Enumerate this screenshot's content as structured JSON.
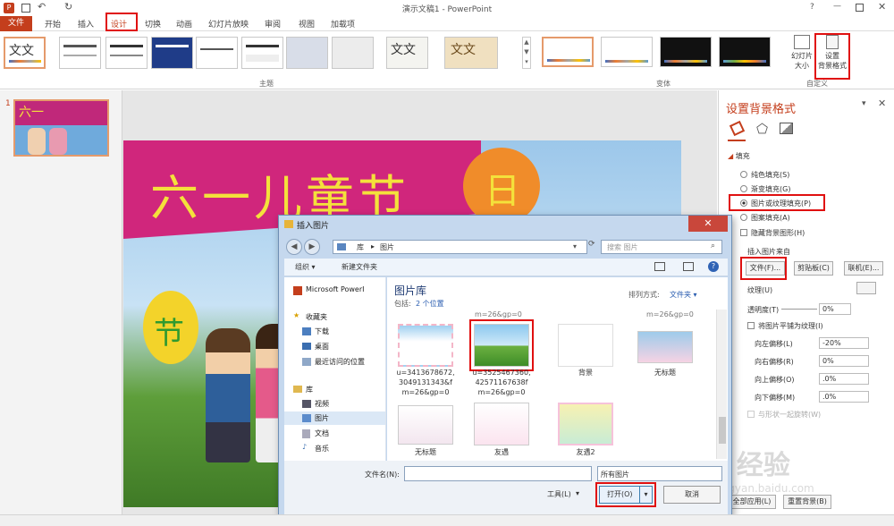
{
  "titlebar": {
    "title": "演示文稿1 - PowerPoint",
    "help": "?"
  },
  "tabs": [
    "文件",
    "开始",
    "插入",
    "设计",
    "切换",
    "动画",
    "幻灯片放映",
    "审阅",
    "视图",
    "加载项"
  ],
  "ribbon": {
    "group_theme": "主题",
    "group_variant": "变体",
    "group_custom": "自定义",
    "theme_text": "文文",
    "slide_size_line1": "幻灯片",
    "slide_size_line2": "大小",
    "format_bg_line1": "设置",
    "format_bg_line2": "背景格式"
  },
  "thumbnail": {
    "number": "1"
  },
  "slide": {
    "title": "六一儿童节",
    "sun_char": "日",
    "jie_char": "节"
  },
  "pane": {
    "title": "设置背景格式",
    "section_fill": "填充",
    "options": [
      "纯色填充(S)",
      "渐变填充(G)",
      "图片或纹理填充(P)",
      "图案填充(A)"
    ],
    "hide_bg": "隐藏背景图形(H)",
    "insert_from": "插入图片来自",
    "btn_file": "文件(F)...",
    "btn_clipboard": "剪贴板(C)",
    "btn_online": "联机(E)...",
    "texture": "纹理(U)",
    "transparency": "透明度(T)",
    "transparency_value": "0%",
    "tile": "将图片平铺为纹理(I)",
    "offsets": [
      {
        "label": "向左偏移(L)",
        "value": "-20%"
      },
      {
        "label": "向右偏移(R)",
        "value": "0%"
      },
      {
        "label": "向上偏移(O)",
        "value": ".0%"
      },
      {
        "label": "向下偏移(M)",
        "value": ".0%"
      }
    ],
    "rotate": "与形状一起旋转(W)",
    "apply_all": "全部应用(L)",
    "reset": "重置背景(B)"
  },
  "dialog": {
    "title": "插入图片",
    "breadcrumb": [
      "库",
      "图片"
    ],
    "search_placeholder": "搜索 图片",
    "organize": "组织 ▾",
    "new_folder": "新建文件夹",
    "nav_top": "Microsoft PowerI",
    "favorites": "收藏夹",
    "fav_items": [
      "下载",
      "桌面",
      "最近访问的位置"
    ],
    "libraries": "库",
    "lib_items": [
      "视频",
      "图片",
      "文档",
      "音乐"
    ],
    "lib_title": "图片库",
    "includes_label": "包括:",
    "includes_link": "2 个位置",
    "arrange_label": "排列方式:",
    "arrange_value": "文件夹 ▾",
    "row0_partial": [
      "m=26&gp=0",
      "m=26&gp=0"
    ],
    "files": [
      {
        "caption": "u=3413678672,\n3049131343&f\nm=26&gp=0"
      },
      {
        "caption": "u=3525467360,\n42571167638f\nm=26&gp=0"
      },
      {
        "caption": "背景"
      },
      {
        "caption": "无标题"
      },
      {
        "caption": "无标题"
      },
      {
        "caption": "友遇"
      },
      {
        "caption": "友遇2"
      }
    ],
    "filename_label": "文件名(N):",
    "filename_value": "",
    "filter_value": "所有图片",
    "tools": "工具(L)",
    "open": "打开(O)",
    "cancel": "取消"
  },
  "watermark": {
    "brand": "Bai 经验",
    "url": "jingyan.baidu.com"
  },
  "colors": {
    "accent": "#c43e1c",
    "highlight": "#e01010",
    "pane_title": "#c43e1c"
  }
}
